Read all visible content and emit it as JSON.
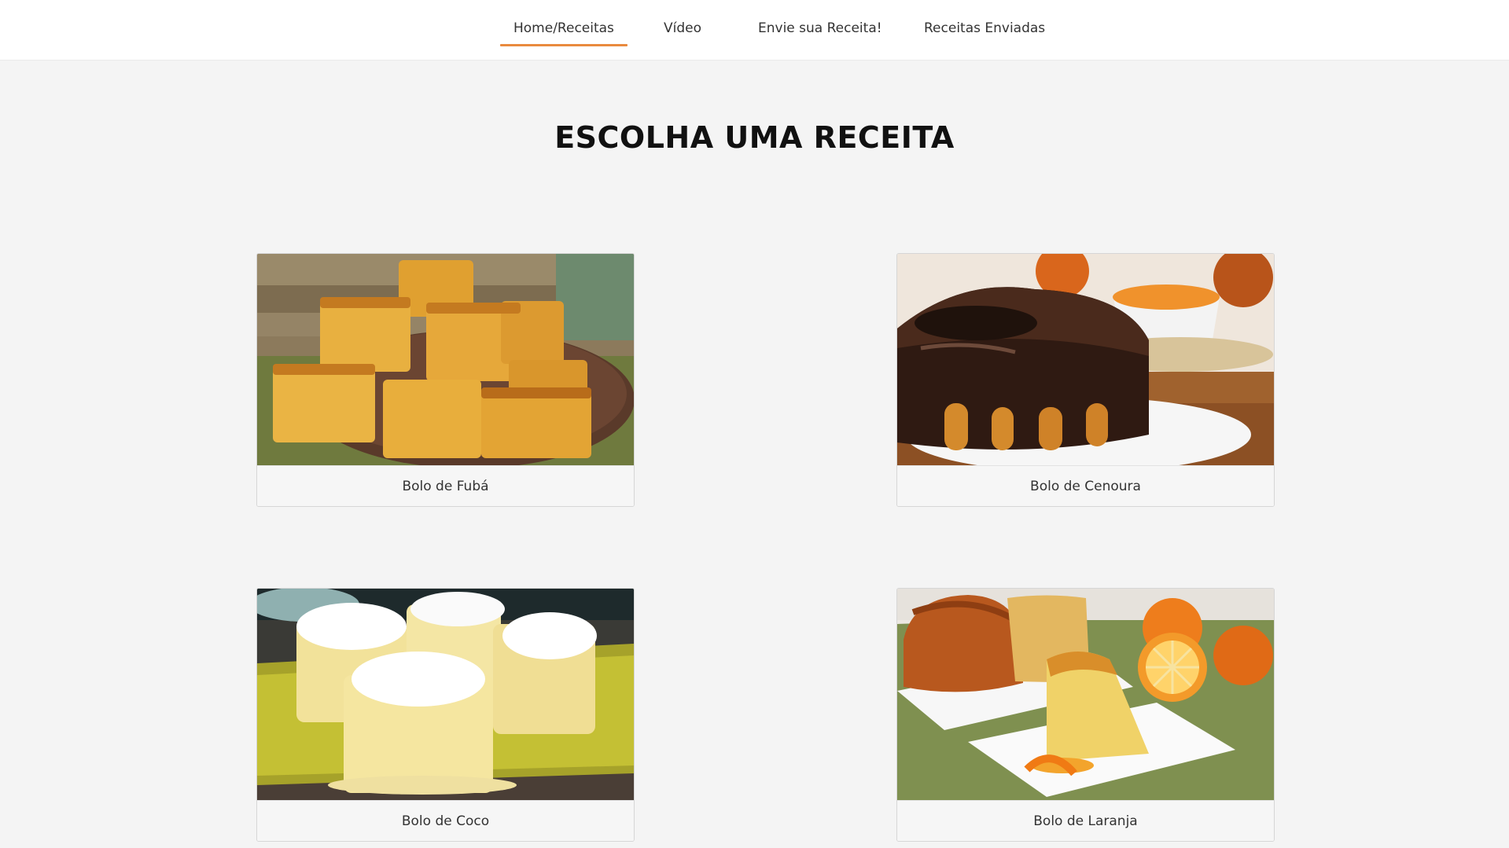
{
  "nav": {
    "items": [
      {
        "label": "Home/Receitas",
        "active": true
      },
      {
        "label": "Vídeo",
        "active": false
      },
      {
        "label": "Envie sua Receita!",
        "active": false
      },
      {
        "label": "Receitas Enviadas",
        "active": false
      }
    ],
    "accent_color": "#e98a3e"
  },
  "page": {
    "title": "ESCOLHA UMA RECEITA"
  },
  "recipes": [
    {
      "name": "Bolo de Fubá",
      "image": "cornmeal-cake-photo"
    },
    {
      "name": "Bolo de Cenoura",
      "image": "carrot-cake-photo"
    },
    {
      "name": "Bolo de Coco",
      "image": "coconut-cake-photo"
    },
    {
      "name": "Bolo de Laranja",
      "image": "orange-cake-photo"
    }
  ]
}
